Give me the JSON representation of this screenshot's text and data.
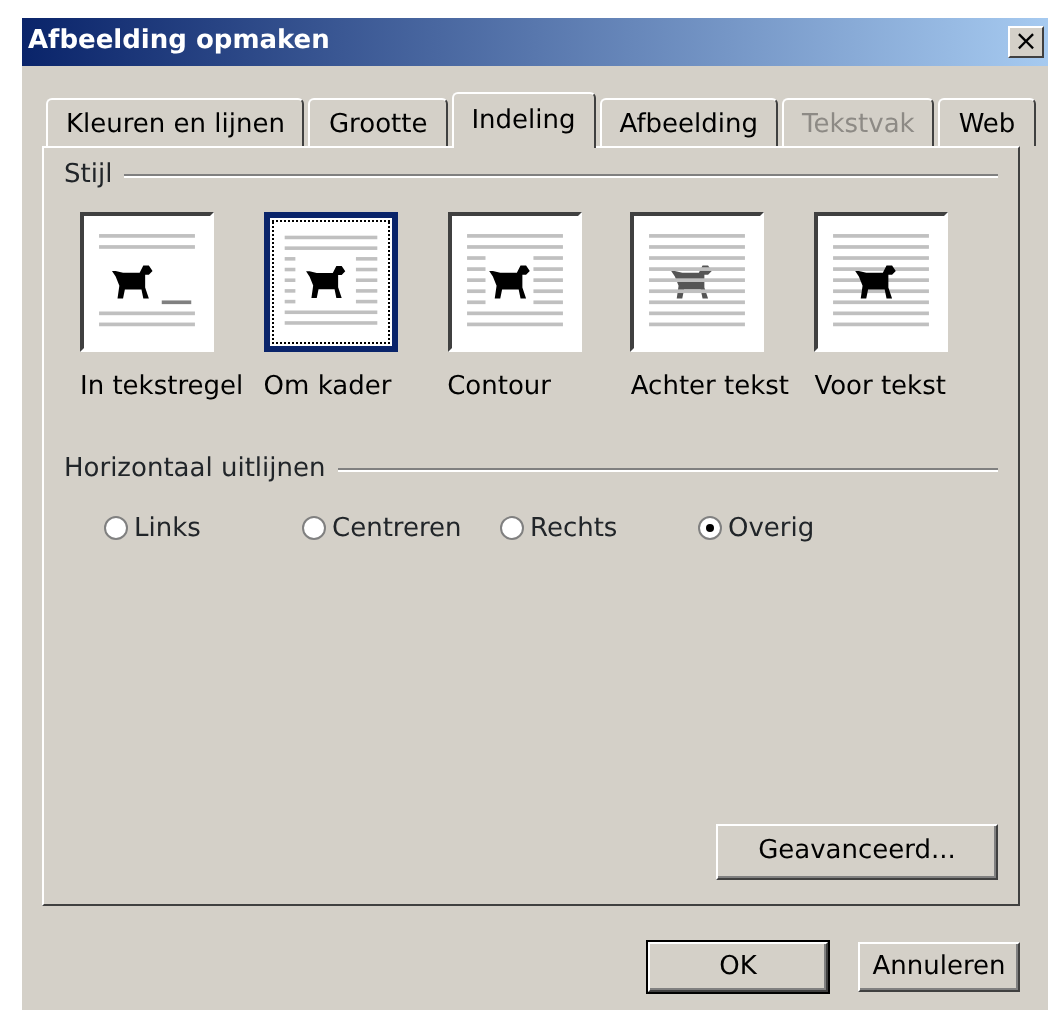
{
  "window": {
    "title": "Afbeelding opmaken",
    "close": "×"
  },
  "tabs": [
    {
      "label": "Kleuren en lijnen",
      "selected": false,
      "disabled": false
    },
    {
      "label": "Grootte",
      "selected": false,
      "disabled": false
    },
    {
      "label": "Indeling",
      "selected": true,
      "disabled": false
    },
    {
      "label": "Afbeelding",
      "selected": false,
      "disabled": false
    },
    {
      "label": "Tekstvak",
      "selected": false,
      "disabled": true
    },
    {
      "label": "Web",
      "selected": false,
      "disabled": false
    }
  ],
  "style_group": {
    "title": "Stijl",
    "options": [
      {
        "label": "In tekstregel",
        "kind": "inline",
        "selected": false
      },
      {
        "label": "Om kader",
        "kind": "square",
        "selected": true
      },
      {
        "label": "Contour",
        "kind": "tight",
        "selected": false
      },
      {
        "label": "Achter tekst",
        "kind": "behind",
        "selected": false
      },
      {
        "label": "Voor tekst",
        "kind": "front",
        "selected": false
      }
    ]
  },
  "align_group": {
    "title": "Horizontaal uitlijnen",
    "options": [
      {
        "label": "Links",
        "selected": false
      },
      {
        "label": "Centreren",
        "selected": false
      },
      {
        "label": "Rechts",
        "selected": false
      },
      {
        "label": "Overig",
        "selected": true
      }
    ]
  },
  "advanced_button": "Geavanceerd...",
  "buttons": [
    {
      "label": "OK",
      "default": true
    },
    {
      "label": "Annuleren",
      "default": false
    }
  ]
}
